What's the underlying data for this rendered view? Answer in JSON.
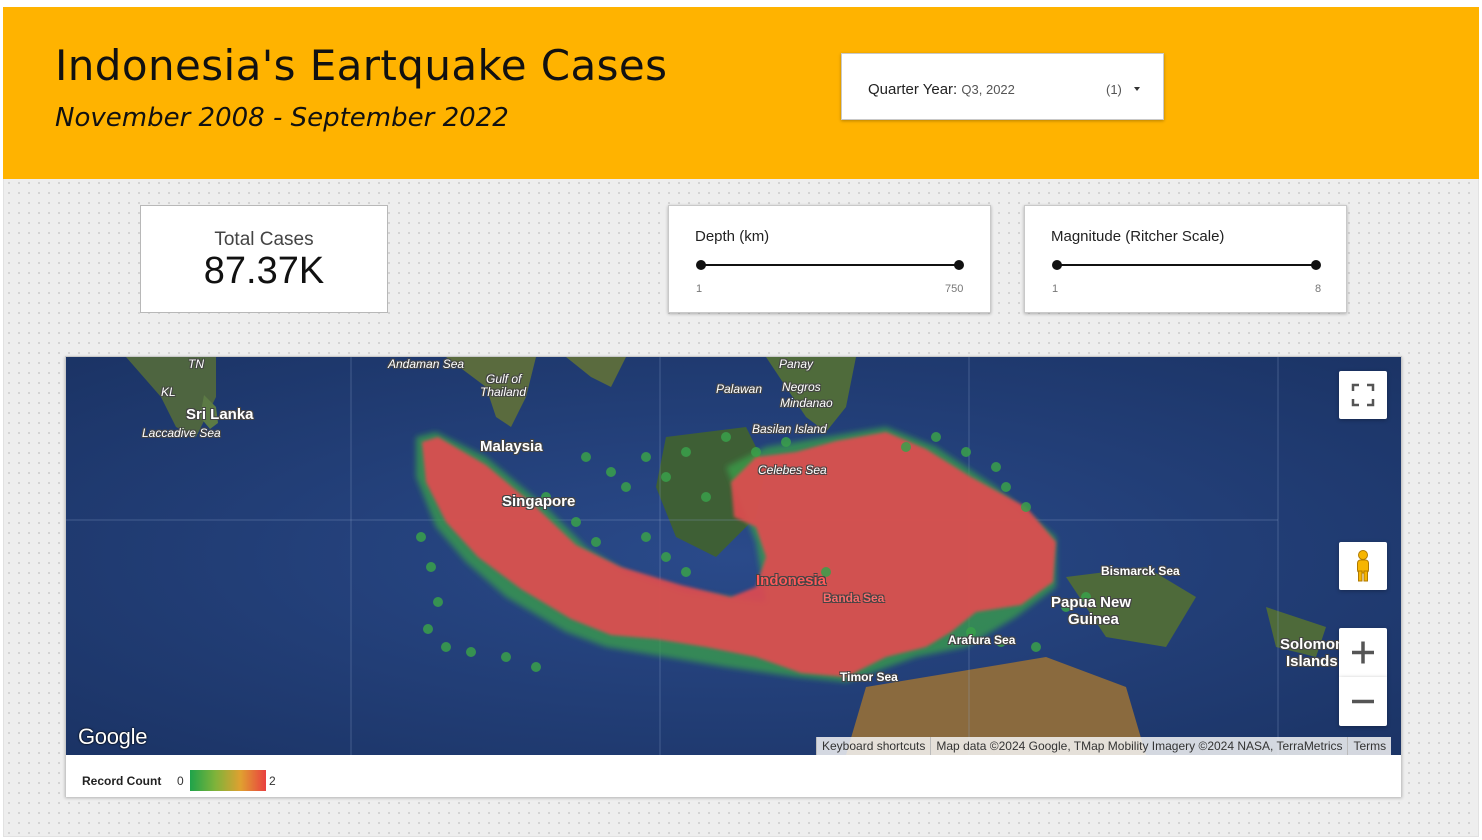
{
  "header": {
    "title": "Indonesia's Eartquake Cases",
    "subtitle": "November 2008 - September 2022",
    "background_color": "#ffb300"
  },
  "filters": {
    "quarter": {
      "label": "Quarter Year:",
      "value": "Q3, 2022",
      "count": "(1)"
    }
  },
  "scorecard": {
    "label": "Total Cases",
    "value": "87.37K"
  },
  "sliders": {
    "depth": {
      "label": "Depth (km)",
      "min": "1",
      "max": "750"
    },
    "magnitude": {
      "label": "Magnitude (Ritcher Scale)",
      "min": "1",
      "max": "8"
    }
  },
  "map": {
    "labels": {
      "tn": "TN",
      "kl": "KL",
      "sri_lanka": "Sri Lanka",
      "laccadive": "Laccadive Sea",
      "andaman": "Andaman Sea",
      "gulf1": "Gulf of",
      "gulf2": "Thailand",
      "panay": "Panay",
      "palawan": "Palawan",
      "negros": "Negros",
      "mindanao": "Mindanao",
      "basilan": "Basilan Island",
      "malaysia": "Malaysia",
      "celebes": "Celebes Sea",
      "singapore": "Singapore",
      "indonesia": "Indonesia",
      "banda": "Banda Sea",
      "bismarck": "Bismarck Sea",
      "png1": "Papua New",
      "png2": "Guinea",
      "arafura": "Arafura Sea",
      "timor": "Timor Sea",
      "solomon1": "Solomon",
      "solomon2": "Islands"
    },
    "google_logo": "Google",
    "attribution": {
      "shortcuts": "Keyboard shortcuts",
      "data": "Map data ©2024 Google, TMap Mobility Imagery ©2024 NASA, TerraMetrics",
      "terms": "Terms"
    },
    "controls": {
      "fullscreen_icon": "fullscreen-icon",
      "pegman_icon": "pegman-icon",
      "zoom_in": "+",
      "zoom_out": "−"
    }
  },
  "legend": {
    "title": "Record Count",
    "min": "0",
    "max": "2",
    "colors": [
      "#1ea34a",
      "#e0a030",
      "#e94040"
    ]
  }
}
